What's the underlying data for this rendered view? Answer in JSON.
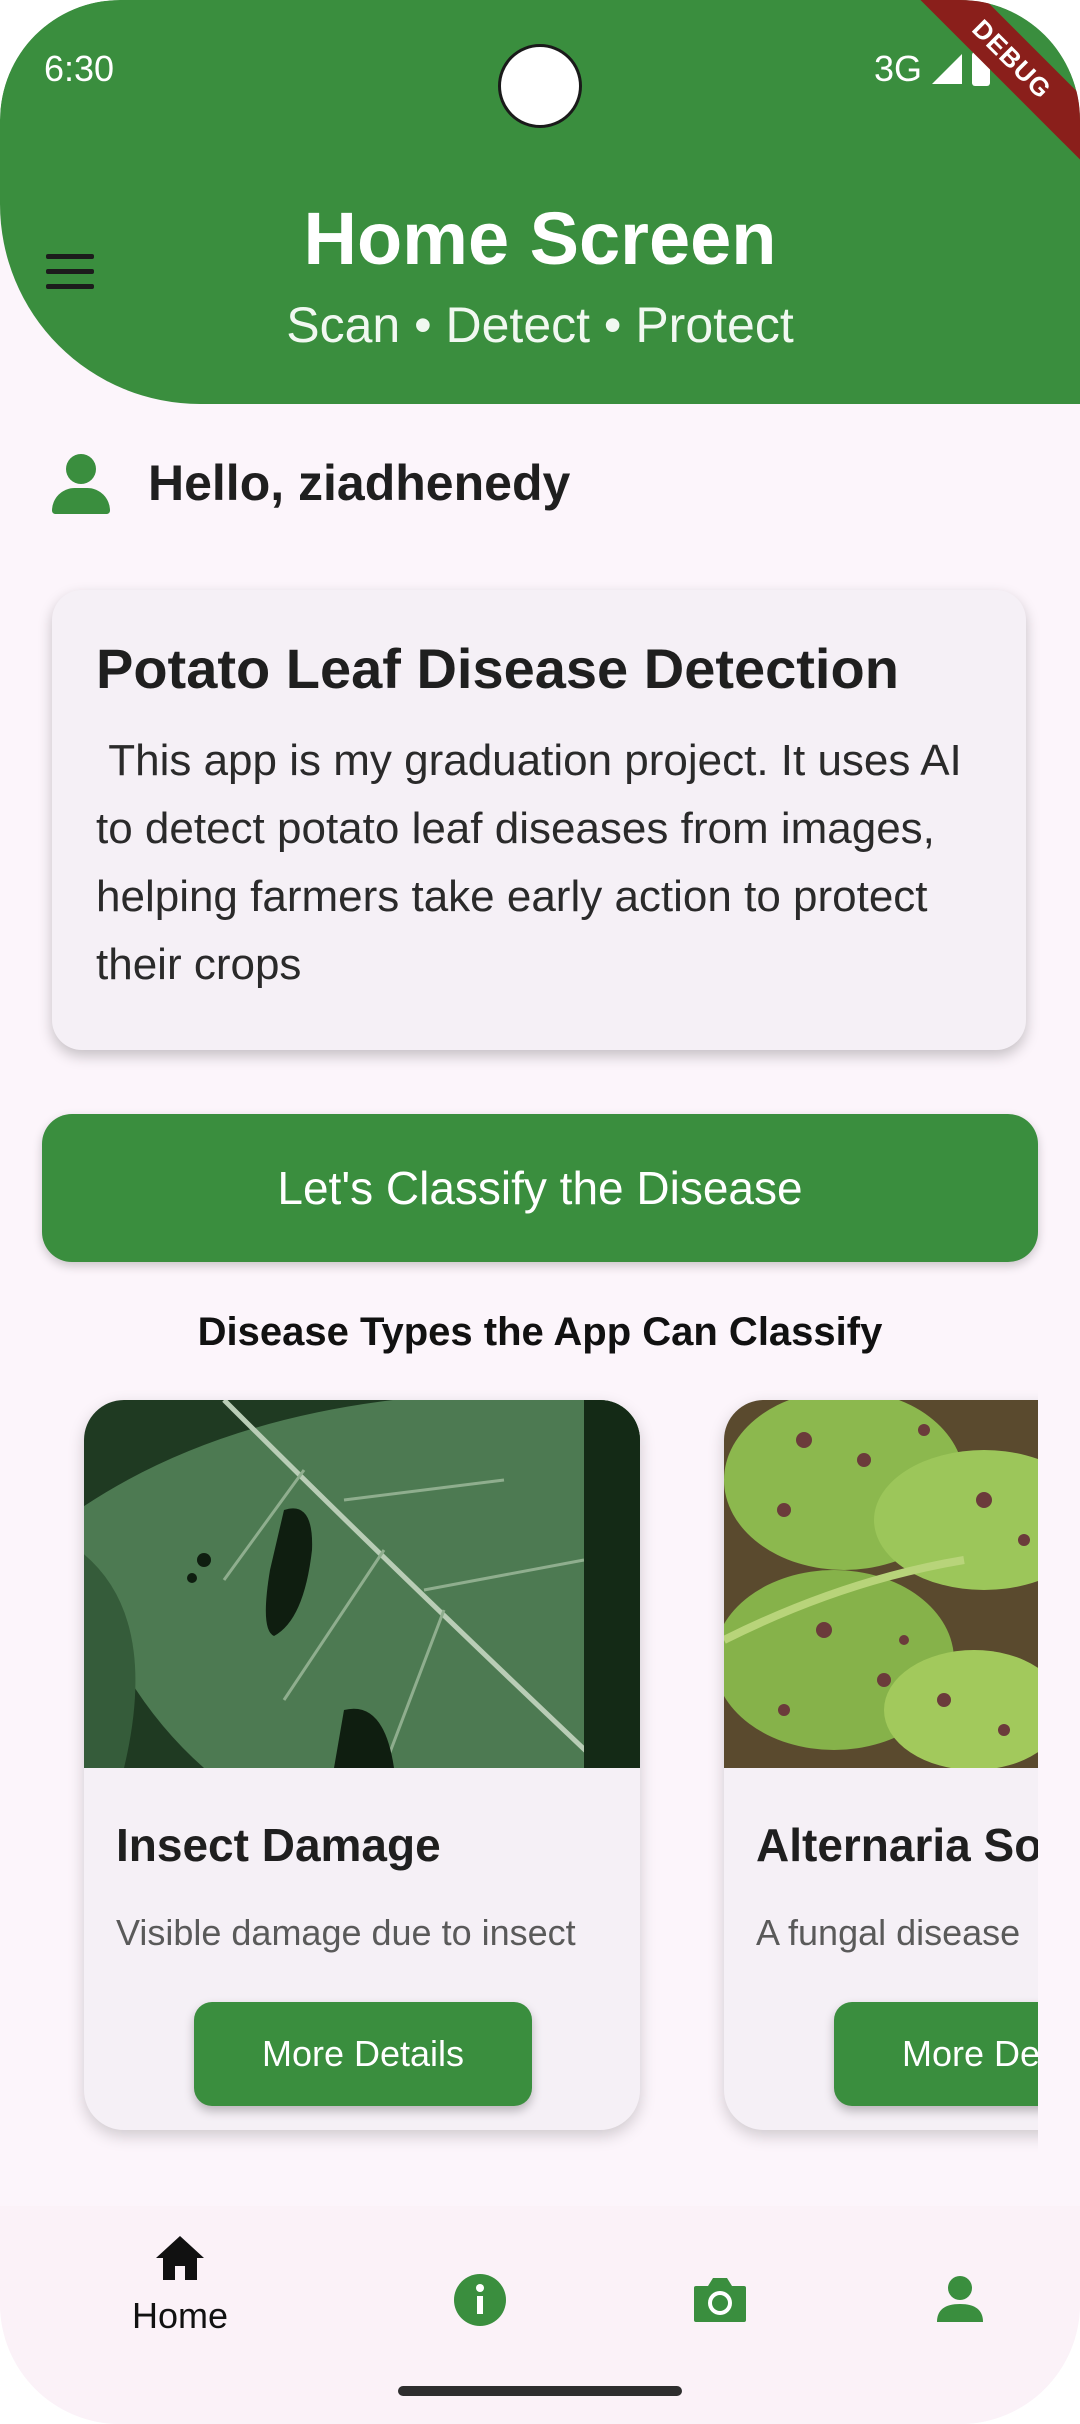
{
  "status_bar": {
    "time": "6:30",
    "network": "3G",
    "debug_label": "DEBUG"
  },
  "app_bar": {
    "title": "Home Screen",
    "subtitle": "Scan • Detect • Protect"
  },
  "greeting": {
    "text": "Hello, ziadhenedy"
  },
  "info_card": {
    "title": "Potato Leaf Disease Detection",
    "body": " This app is my graduation project. It uses AI to detect potato leaf diseases from images, helping farmers take early action to protect their crops"
  },
  "classify_button": {
    "label": "Let's Classify the Disease"
  },
  "section": {
    "title": "Disease Types the App Can Classify"
  },
  "diseases": [
    {
      "title": "Insect Damage",
      "description": "Visible damage due to insect",
      "button": "More Details"
    },
    {
      "title": "Alternaria Solani",
      "description": "A fungal disease",
      "button": "More Details"
    }
  ],
  "bottom_nav": {
    "items": [
      {
        "label": "Home",
        "icon": "home-icon",
        "active": true
      },
      {
        "label": "",
        "icon": "info-icon",
        "active": false
      },
      {
        "label": "",
        "icon": "camera-icon",
        "active": false
      },
      {
        "label": "",
        "icon": "person-icon",
        "active": false
      }
    ]
  },
  "colors": {
    "primary": "#3a8e3e",
    "background": "#fcf5fb",
    "card": "#f5f0f6",
    "debug_ribbon": "#8a1f1b"
  }
}
